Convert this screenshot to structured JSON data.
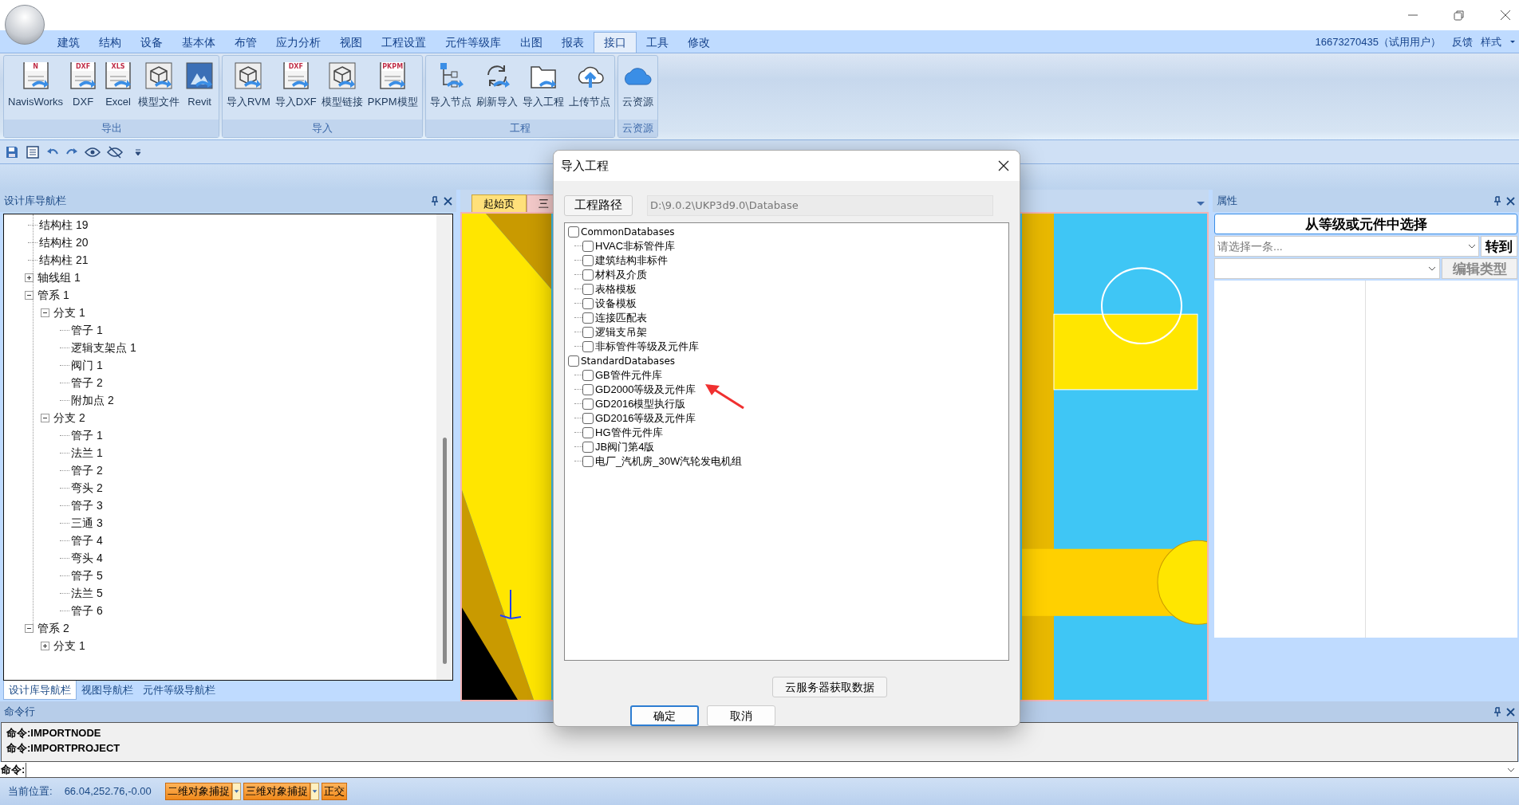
{
  "window": {
    "user": "16673270435（试用用户）",
    "links": [
      "反馈",
      "样式"
    ]
  },
  "menu_tabs": [
    {
      "label": "建筑",
      "selected": false
    },
    {
      "label": "结构",
      "selected": false
    },
    {
      "label": "设备",
      "selected": false
    },
    {
      "label": "基本体",
      "selected": false
    },
    {
      "label": "布管",
      "selected": false
    },
    {
      "label": "应力分析",
      "selected": false
    },
    {
      "label": "视图",
      "selected": false
    },
    {
      "label": "工程设置",
      "selected": false
    },
    {
      "label": "元件等级库",
      "selected": false
    },
    {
      "label": "出图",
      "selected": false
    },
    {
      "label": "报表",
      "selected": false
    },
    {
      "label": "接口",
      "selected": true
    },
    {
      "label": "工具",
      "selected": false
    },
    {
      "label": "修改",
      "selected": false
    }
  ],
  "ribbon_groups": [
    {
      "title": "导出",
      "buttons": [
        {
          "label": "NavisWorks",
          "kind": "doc",
          "badge": "N"
        },
        {
          "label": "DXF",
          "kind": "doc",
          "badge": "DXF"
        },
        {
          "label": "Excel",
          "kind": "doc",
          "badge": "XLS"
        },
        {
          "label": "模型文件",
          "kind": "cube"
        },
        {
          "label": "Revit",
          "kind": "photo"
        }
      ]
    },
    {
      "title": "导入",
      "buttons": [
        {
          "label": "导入RVM",
          "kind": "cube"
        },
        {
          "label": "导入DXF",
          "kind": "doc",
          "badge": "DXF"
        },
        {
          "label": "模型链接",
          "kind": "cube"
        },
        {
          "label": "PKPM模型",
          "kind": "doc",
          "badge": "PKPM"
        }
      ]
    },
    {
      "title": "工程",
      "buttons": [
        {
          "label": "导入节点",
          "kind": "tree"
        },
        {
          "label": "刷新导入",
          "kind": "refresh"
        },
        {
          "label": "导入工程",
          "kind": "folder"
        },
        {
          "label": "上传节点",
          "kind": "upload"
        }
      ]
    },
    {
      "title": "云资源",
      "buttons": [
        {
          "label": "云资源",
          "kind": "cloud"
        }
      ]
    }
  ],
  "left_panel": {
    "title": "设计库导航栏",
    "tree": [
      {
        "label": "结构柱 19"
      },
      {
        "label": "结构柱 20"
      },
      {
        "label": "结构柱 21"
      },
      {
        "label": "轴线组 1",
        "expanded": false
      },
      {
        "label": "管系 1",
        "expanded": true,
        "children": [
          {
            "label": "分支 1",
            "expanded": true,
            "children": [
              {
                "label": "管子 1"
              },
              {
                "label": "逻辑支架点 1"
              },
              {
                "label": "阀门 1"
              },
              {
                "label": "管子 2"
              },
              {
                "label": "附加点 2"
              }
            ]
          },
          {
            "label": "分支 2",
            "expanded": true,
            "children": [
              {
                "label": "管子 1"
              },
              {
                "label": "法兰 1"
              },
              {
                "label": "管子 2"
              },
              {
                "label": "弯头 2"
              },
              {
                "label": "管子 3"
              },
              {
                "label": "三通 3"
              },
              {
                "label": "管子 4"
              },
              {
                "label": "弯头 4"
              },
              {
                "label": "管子 5"
              },
              {
                "label": "法兰 5"
              },
              {
                "label": "管子 6"
              }
            ]
          }
        ]
      },
      {
        "label": "管系 2",
        "expanded": true,
        "children": [
          {
            "label": "分支 1",
            "expanded": false
          }
        ]
      }
    ],
    "tabs": [
      {
        "label": "设计库导航栏",
        "selected": true
      },
      {
        "label": "视图导航栏",
        "selected": false
      },
      {
        "label": "元件等级导航栏",
        "selected": false
      }
    ]
  },
  "viewport": {
    "tabs": [
      {
        "label": "起始页",
        "selected": true
      },
      {
        "label": "三",
        "selected": false
      }
    ]
  },
  "right_panel": {
    "title": "属性",
    "select_button": "从等级或元件中选择",
    "select_placeholder": "请选择一条...",
    "goto_button": "转到",
    "edit_type_button": {
      "label": "编辑类型",
      "disabled": true
    }
  },
  "command_panel": {
    "title": "命令行",
    "lines": [
      "命令:IMPORTNODE",
      "命令:IMPORTPROJECT"
    ],
    "prompt": "命令:"
  },
  "status_bar": {
    "position_label": "当前位置:",
    "position": "66.04,252.76,-0.00",
    "toggles": [
      {
        "label": "二维对象捕捉",
        "on": true,
        "dropdown": true
      },
      {
        "label": "三维对象捕捉",
        "on": true,
        "dropdown": true
      },
      {
        "label": "正交",
        "on": true,
        "dropdown": false
      }
    ]
  },
  "dialog": {
    "title": "导入工程",
    "path_button": "工程路径",
    "path": "D:\\9.0.2\\UKP3d9.0\\Database",
    "tree": [
      {
        "label": "CommonDatabases",
        "checked": false,
        "children": [
          {
            "label": "HVAC非标管件库",
            "checked": false
          },
          {
            "label": "建筑结构非标件",
            "checked": false
          },
          {
            "label": "材料及介质",
            "checked": false
          },
          {
            "label": "表格模板",
            "checked": false
          },
          {
            "label": "设备模板",
            "checked": false
          },
          {
            "label": "连接匹配表",
            "checked": false
          },
          {
            "label": "逻辑支吊架",
            "checked": false
          },
          {
            "label": "非标管件等级及元件库",
            "checked": false
          }
        ]
      },
      {
        "label": "StandardDatabases",
        "checked": false,
        "children": [
          {
            "label": "GB管件元件库",
            "checked": false
          },
          {
            "label": "GD2000等级及元件库",
            "checked": false
          },
          {
            "label": "GD2016模型执行版",
            "checked": false
          },
          {
            "label": "GD2016等级及元件库",
            "checked": false
          },
          {
            "label": "HG管件元件库",
            "checked": false
          },
          {
            "label": "JB阀门第4版",
            "checked": false
          },
          {
            "label": "电厂_汽机房_30W汽轮发电机组",
            "checked": false
          }
        ]
      }
    ],
    "cloud_button": "云服务器获取数据",
    "buttons": [
      {
        "label": "确定",
        "kind": "default"
      },
      {
        "label": "取消",
        "kind": "normal"
      }
    ]
  }
}
